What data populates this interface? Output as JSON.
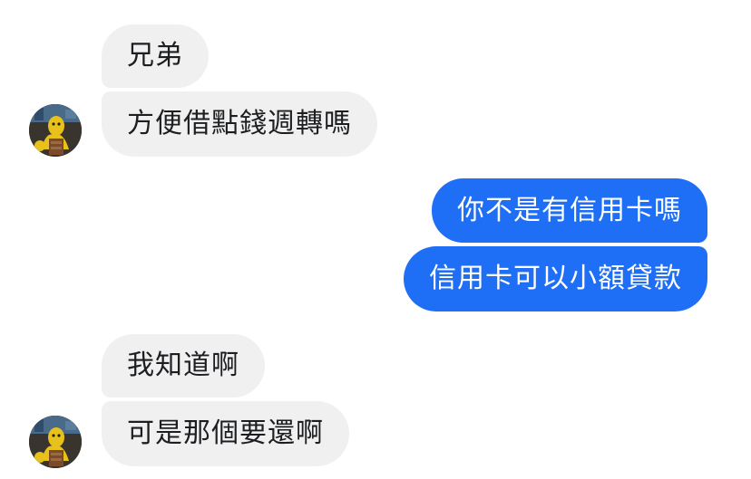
{
  "messages": [
    {
      "id": "b1",
      "side": "incoming",
      "text": "兄弟"
    },
    {
      "id": "b2",
      "side": "incoming",
      "text": "方便借點錢週轉嗎"
    },
    {
      "id": "b3",
      "side": "outgoing",
      "text": "你不是有信用卡嗎"
    },
    {
      "id": "b4",
      "side": "outgoing",
      "text": "信用卡可以小額貸款"
    },
    {
      "id": "b5",
      "side": "incoming",
      "text": "我知道啊"
    },
    {
      "id": "b6",
      "side": "incoming",
      "text": "可是那個要還啊"
    }
  ],
  "colors": {
    "incoming_bubble": "#f0f0f0",
    "incoming_text": "#1c1e21",
    "outgoing_bubble": "#1e6ff5",
    "outgoing_text": "#ffffff"
  },
  "icons": {
    "avatar": "contact-avatar-icon"
  }
}
